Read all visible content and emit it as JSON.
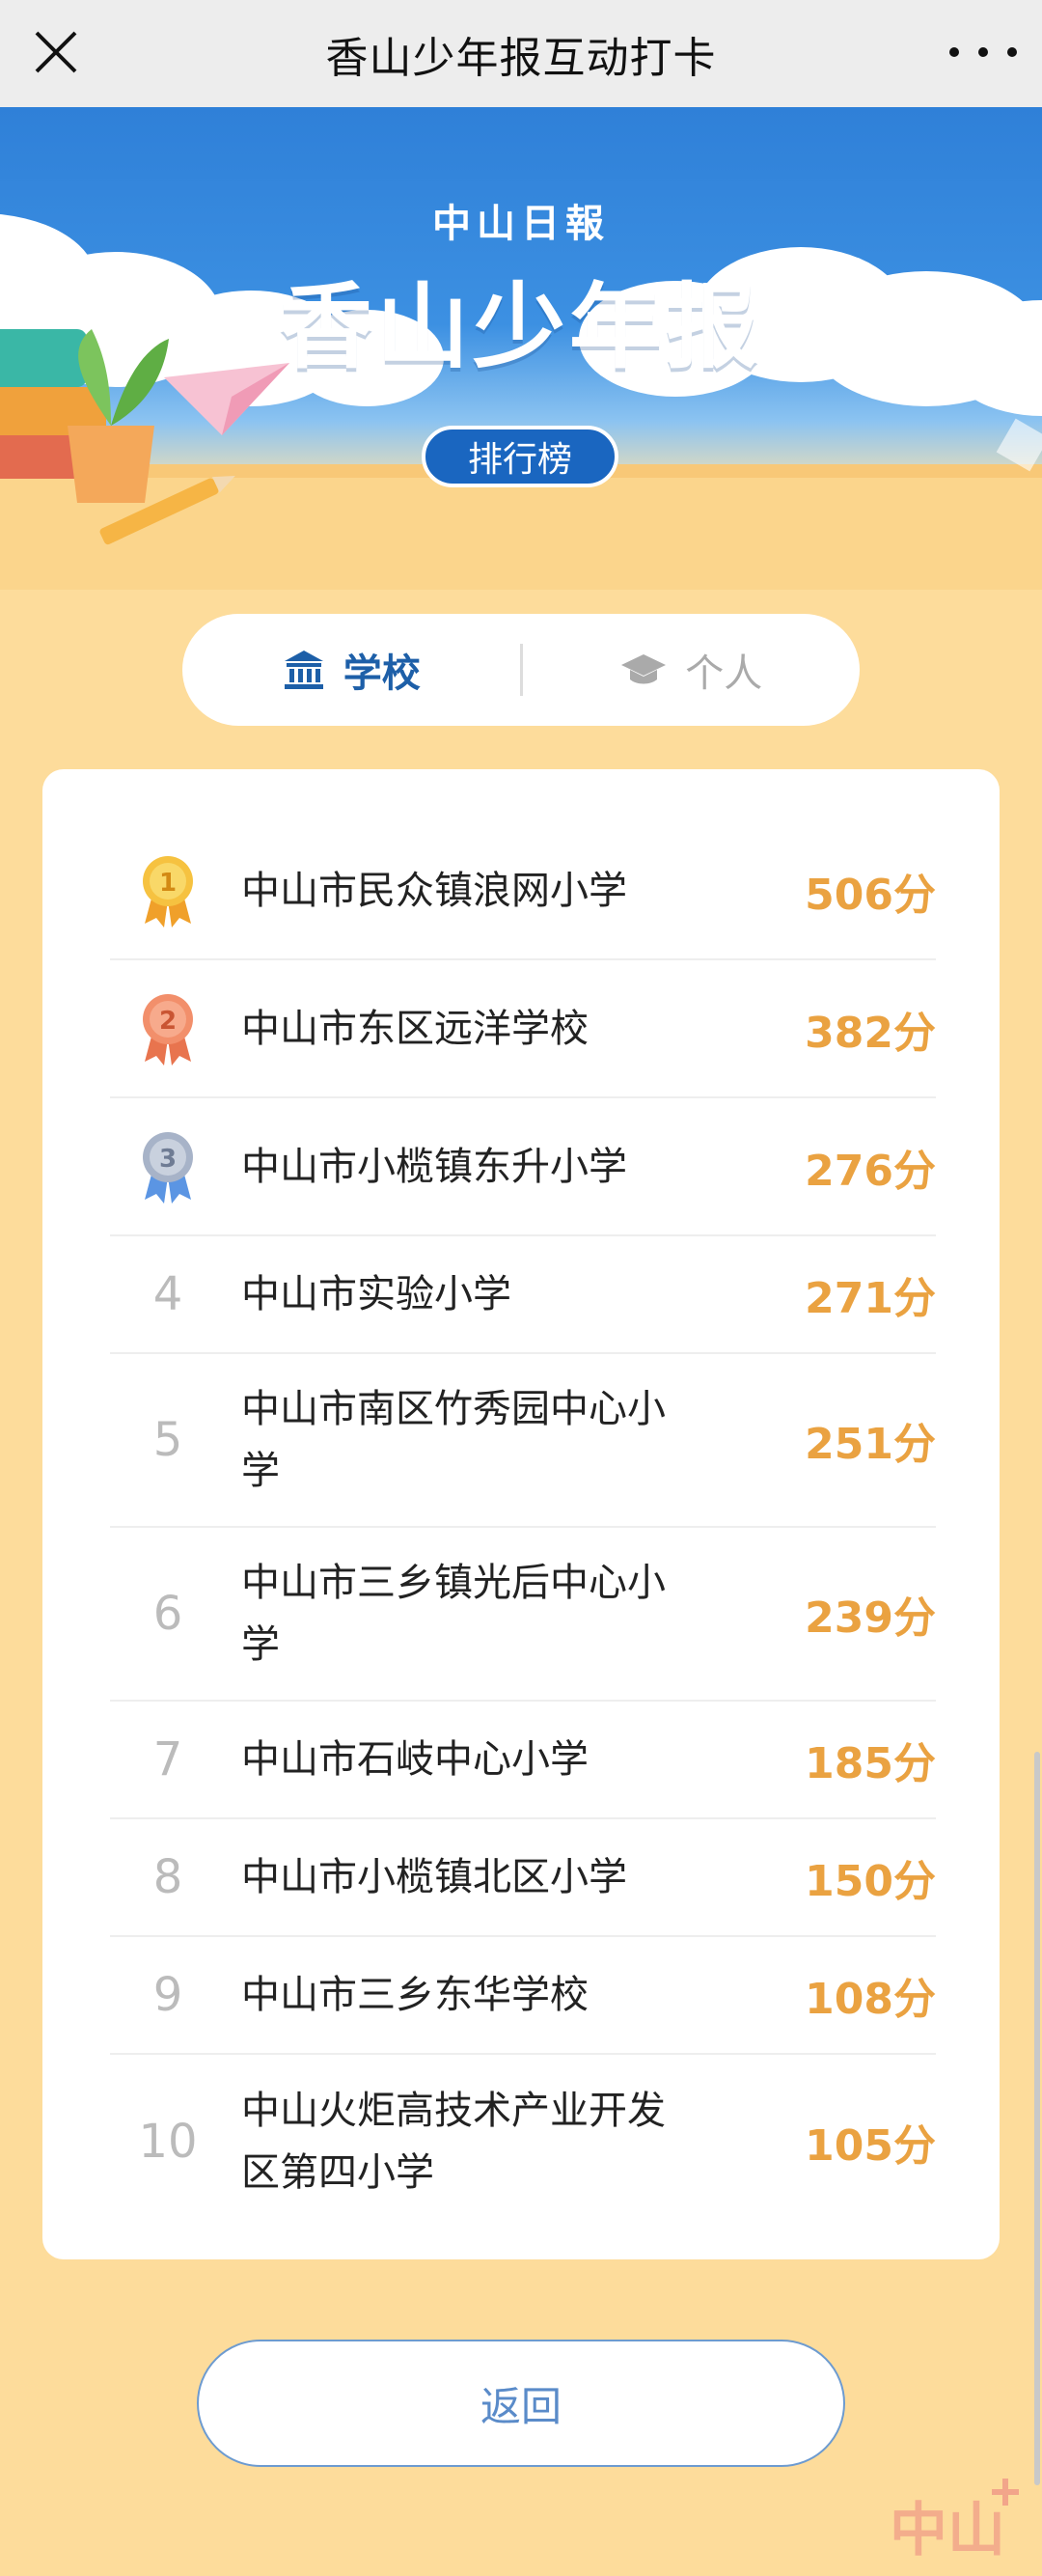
{
  "header": {
    "title": "香山少年报互动打卡"
  },
  "banner": {
    "brand_small": "中山日報",
    "brand_big": "香山少年报",
    "rank_label": "排行榜"
  },
  "tabs": [
    {
      "label": "学校",
      "active": true,
      "icon": "school-building-icon"
    },
    {
      "label": "个人",
      "active": false,
      "icon": "graduation-cap-icon"
    }
  ],
  "ranking": [
    {
      "rank": "1",
      "medal": "gold",
      "name": "中山市民众镇浪网小学",
      "score": "506分"
    },
    {
      "rank": "2",
      "medal": "bronze",
      "name": "中山市东区远洋学校",
      "score": "382分"
    },
    {
      "rank": "3",
      "medal": "silver",
      "name": "中山市小榄镇东升小学",
      "score": "276分"
    },
    {
      "rank": "4",
      "name": "中山市实验小学",
      "score": "271分"
    },
    {
      "rank": "5",
      "name": "中山市南区竹秀园中心小学",
      "score": "251分"
    },
    {
      "rank": "6",
      "name": "中山市三乡镇光后中心小学",
      "score": "239分"
    },
    {
      "rank": "7",
      "name": "中山市石岐中心小学",
      "score": "185分"
    },
    {
      "rank": "8",
      "name": "中山市小榄镇北区小学",
      "score": "150分"
    },
    {
      "rank": "9",
      "name": "中山市三乡东华学校",
      "score": "108分"
    },
    {
      "rank": "10",
      "name": "中山火炬高技术产业开发区第四小学",
      "score": "105分"
    }
  ],
  "back_label": "返回",
  "watermark": "中山",
  "colors": {
    "accent": "#1d5fa8",
    "score": "#eaa241",
    "background": "#fddc9b"
  }
}
